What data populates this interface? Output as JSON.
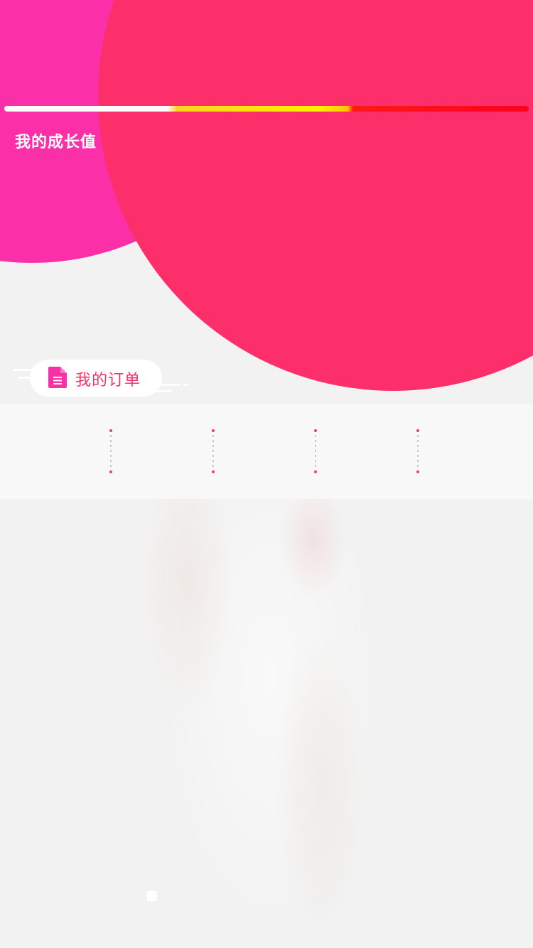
{
  "growth": {
    "label": "我的成长值",
    "bar_colors": [
      "#ffffff",
      "#fff200",
      "#ff0020"
    ]
  },
  "orders": {
    "label": "我的订单",
    "icon": "document-icon"
  },
  "theme": {
    "circle_magenta": "#fb2fa7",
    "circle_red": "#fd2f6a",
    "accent": "#fd2f6a"
  }
}
